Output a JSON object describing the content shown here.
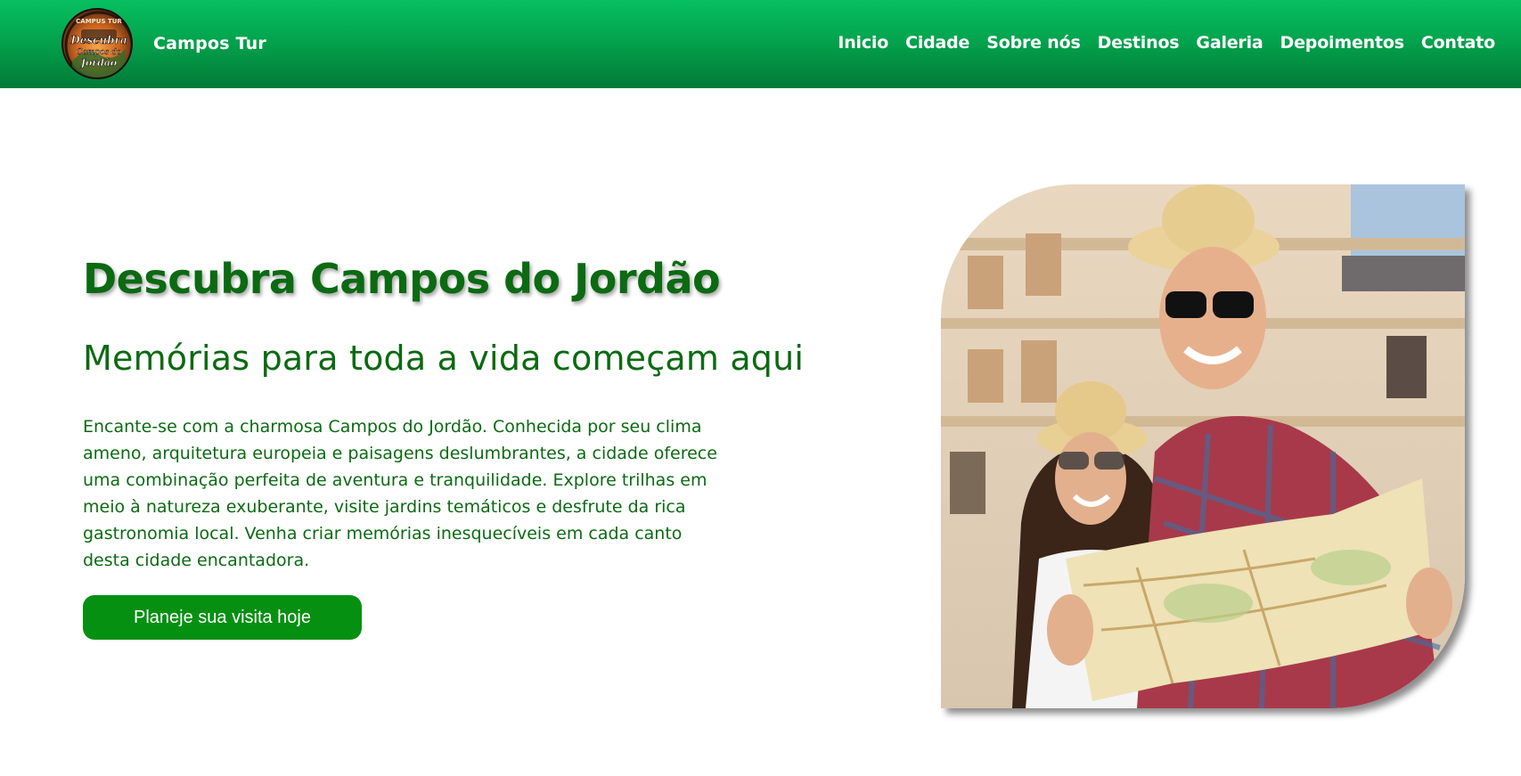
{
  "header": {
    "brand_name": "Campos Tur",
    "logo_text": [
      "CAMPUS TUR",
      "Descubra",
      "Campos do",
      "Jordão"
    ],
    "nav_items": [
      "Inicio",
      "Cidade",
      "Sobre nós",
      "Destinos",
      "Galeria",
      "Depoimentos",
      "Contato"
    ]
  },
  "hero": {
    "title": "Descubra Campos do Jordão",
    "subtitle": "Memórias para toda a vida começam aqui",
    "description": "Encante-se com a charmosa Campos do Jordão. Conhecida por seu clima ameno, arquitetura europeia e paisagens deslumbrantes, a cidade oferece uma combinação perfeita de aventura e tranquilidade. Explore trilhas em meio à natureza exuberante, visite jardins temáticos e desfrute da rica gastronomia local. Venha criar memórias inesquecíveis em cada canto desta cidade encantadora.",
    "cta_label": "Planeje sua visita hoje"
  },
  "colors": {
    "header_green": "#03a44e",
    "text_green": "#0b6a12",
    "button_green": "#059012"
  }
}
